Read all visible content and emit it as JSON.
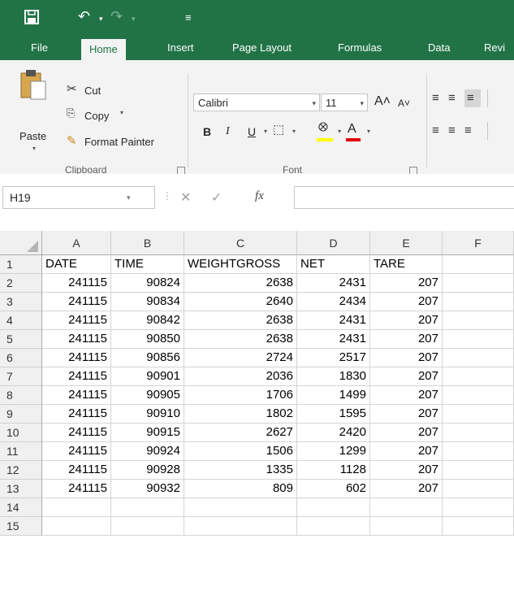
{
  "qat": {
    "save_icon": "save-icon",
    "undo_icon": "undo-icon",
    "redo_icon": "redo-icon",
    "customize_icon": "customize-qat-icon"
  },
  "tabs": [
    "File",
    "Home",
    "Insert",
    "Page Layout",
    "Formulas",
    "Data",
    "Revi"
  ],
  "active_tab": "Home",
  "clipboard": {
    "paste": "Paste",
    "cut": "Cut",
    "copy": "Copy",
    "format_painter": "Format Painter",
    "label": "Clipboard"
  },
  "font": {
    "name": "Calibri",
    "size": "11",
    "label": "Font",
    "bold": "B",
    "italic": "I",
    "underline": "U"
  },
  "formula_bar": {
    "name_box": "H19",
    "fx": "fx",
    "value": ""
  },
  "columns": [
    "A",
    "B",
    "C",
    "D",
    "E",
    "F"
  ],
  "rows": [
    [
      "DATE",
      "TIME",
      "WEIGHTGROSS",
      "NET",
      "TARE",
      ""
    ],
    [
      "241115",
      "90824",
      "2638",
      "2431",
      "207",
      ""
    ],
    [
      "241115",
      "90834",
      "2640",
      "2434",
      "207",
      ""
    ],
    [
      "241115",
      "90842",
      "2638",
      "2431",
      "207",
      ""
    ],
    [
      "241115",
      "90850",
      "2638",
      "2431",
      "207",
      ""
    ],
    [
      "241115",
      "90856",
      "2724",
      "2517",
      "207",
      ""
    ],
    [
      "241115",
      "90901",
      "2036",
      "1830",
      "207",
      ""
    ],
    [
      "241115",
      "90905",
      "1706",
      "1499",
      "207",
      ""
    ],
    [
      "241115",
      "90910",
      "1802",
      "1595",
      "207",
      ""
    ],
    [
      "241115",
      "90915",
      "2627",
      "2420",
      "207",
      ""
    ],
    [
      "241115",
      "90924",
      "1506",
      "1299",
      "207",
      ""
    ],
    [
      "241115",
      "90928",
      "1335",
      "1128",
      "207",
      ""
    ],
    [
      "241115",
      "90932",
      "809",
      "602",
      "207",
      ""
    ],
    [
      "",
      "",
      "",
      "",
      "",
      ""
    ],
    [
      "",
      "",
      "",
      "",
      "",
      ""
    ]
  ],
  "row_numbers": [
    "1",
    "2",
    "3",
    "4",
    "5",
    "6",
    "7",
    "8",
    "9",
    "10",
    "11",
    "12",
    "13",
    "14",
    "15"
  ],
  "colors": {
    "accent": "#217346",
    "ribbon_bg": "#f3f3f3",
    "header_bg": "#f0f0f0",
    "gridline": "#d4d4d4"
  }
}
